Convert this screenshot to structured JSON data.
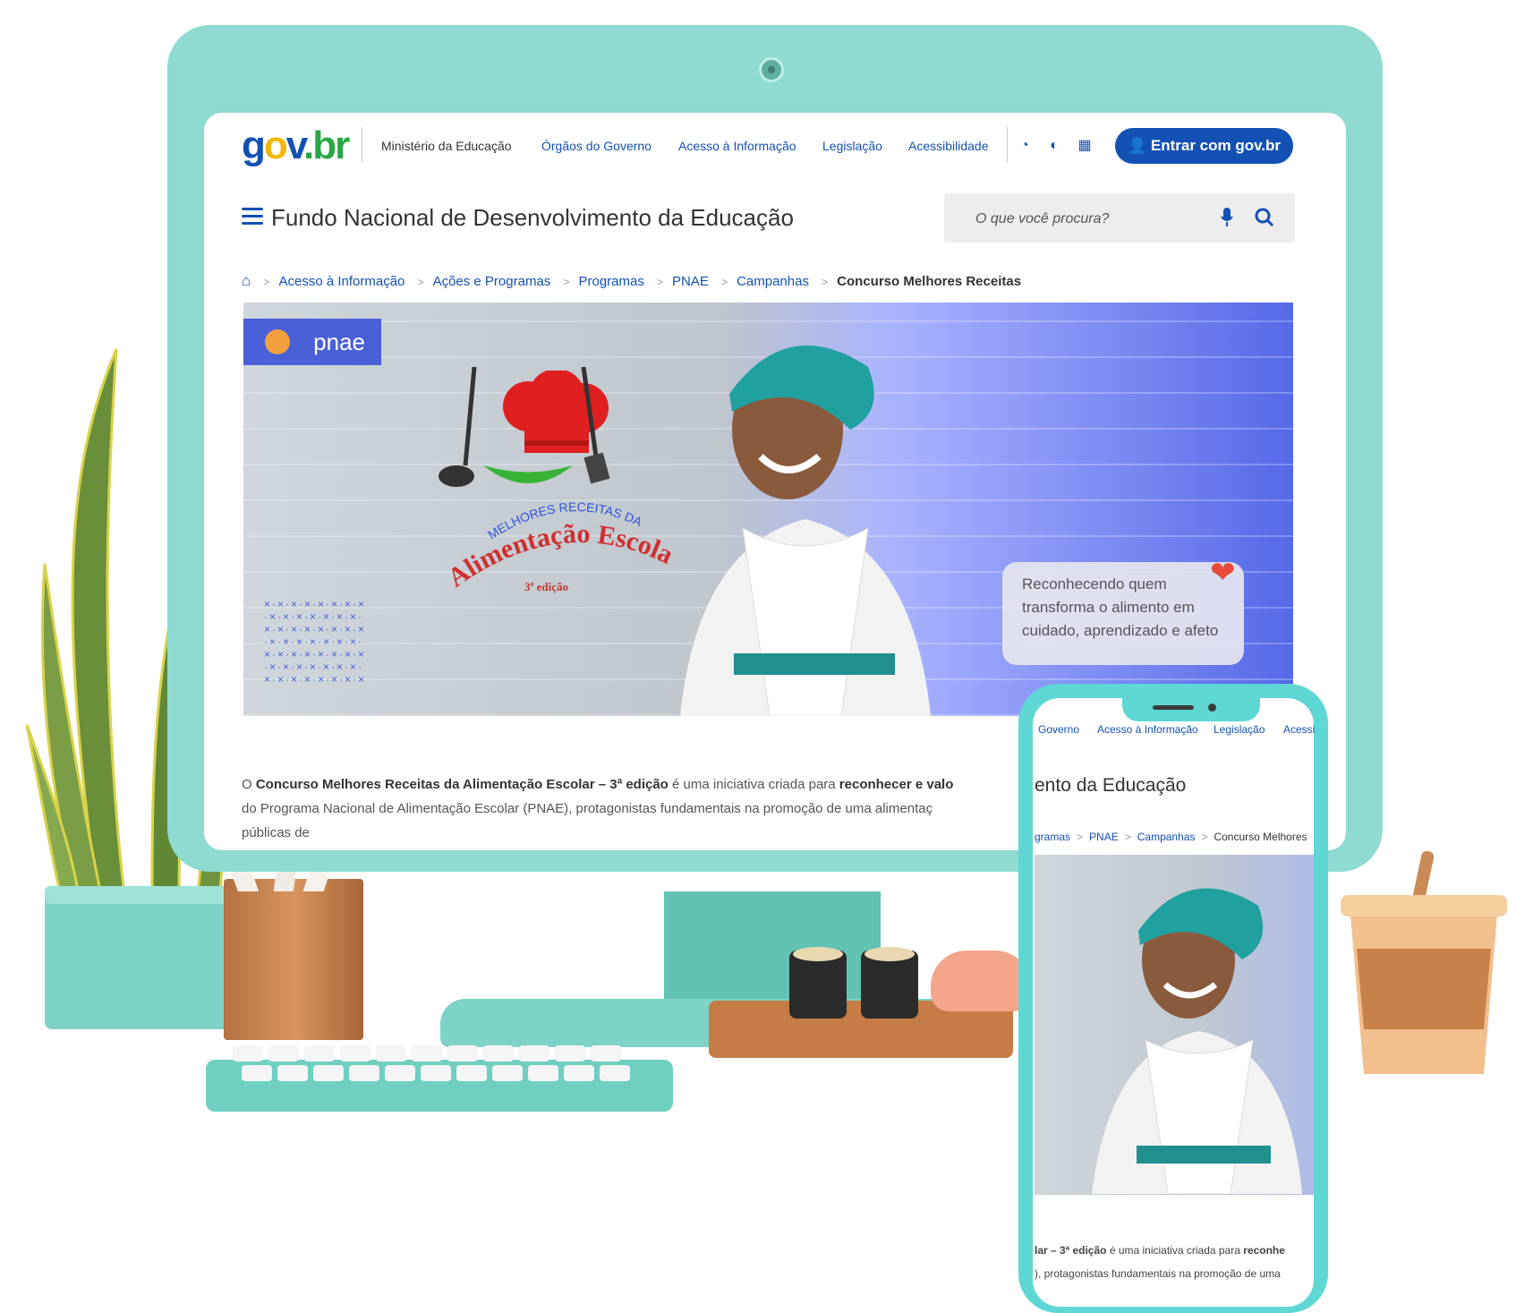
{
  "desktop": {
    "logo": {
      "part1": "g",
      "part2": "o",
      "part3": "v",
      "part4": ".br"
    },
    "header_links": [
      "Ministério da Educação",
      "Órgãos do Governo",
      "Acesso à Informação",
      "Legislação",
      "Acessibilidade"
    ],
    "header_icons": [
      "contrast-icon",
      "theme-icon",
      "apps-grid-icon"
    ],
    "login_label": "Entrar com gov.br",
    "site_title": "Fundo Nacional de Desenvolvimento da Educação",
    "search_placeholder": "O que você procura?",
    "breadcrumb": [
      "Acesso à Informação",
      "Ações e Programas",
      "Programas",
      "PNAE",
      "Campanhas",
      "Concurso Melhores Receitas"
    ],
    "banner": {
      "badge": "pnae",
      "logo_line1": "MELHORES RECEITAS DA",
      "logo_line2": "Alimentação Escolar",
      "edition": "3ª edição",
      "quote": "Reconhecendo quem transforma o alimento em cuidado, aprendizado e afeto"
    },
    "intro": {
      "p1": "O ",
      "b1": "Concurso Melhores Receitas da Alimentação Escolar – 3ª edição",
      "p2": " é uma iniciativa criada para ",
      "b2": "reconhecer e valo",
      "line2": "do Programa Nacional de Alimentação Escolar (PNAE), protagonistas fundamentais na promoção de uma alimentaç",
      "line3": "públicas de"
    }
  },
  "mobile": {
    "links": [
      "Governo",
      "Acesso à Informação",
      "Legislação",
      "Acessi"
    ],
    "title": "ento da Educação",
    "breadcrumb": [
      "gramas",
      "PNAE",
      "Campanhas",
      "Concurso Melhores"
    ],
    "text_line1_a": "lar – 3ª edição",
    "text_line1_b": " é uma iniciativa criada para ",
    "text_line1_c": "reconhe",
    "text_line2": "), protagonistas fundamentais na promoção de uma"
  },
  "colors": {
    "brand_blue": "#1351b4",
    "monitor_teal": "#8fdad1",
    "phone_teal": "#5fd7d4"
  }
}
